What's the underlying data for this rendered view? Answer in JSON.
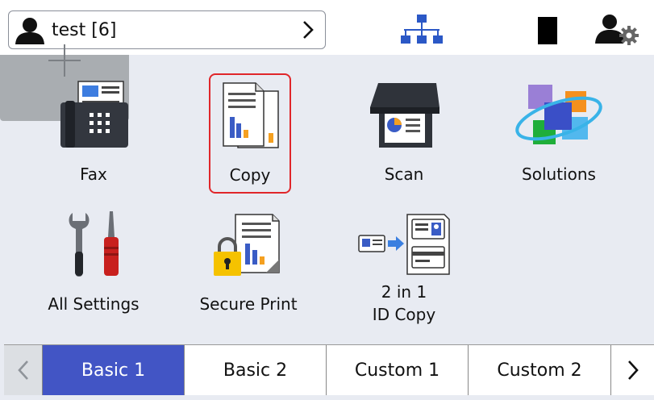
{
  "header": {
    "user_label": "test [6]"
  },
  "tiles": {
    "fax": "Fax",
    "copy": "Copy",
    "scan": "Scan",
    "solutions": "Solutions",
    "all_settings": "All Settings",
    "secure_print": "Secure Print",
    "id_copy_line1": "2 in 1",
    "id_copy_line2": "ID Copy"
  },
  "tabs": [
    {
      "label": "Basic 1",
      "active": true
    },
    {
      "label": "Basic 2",
      "active": false
    },
    {
      "label": "Custom 1",
      "active": false
    },
    {
      "label": "Custom 2",
      "active": false
    }
  ],
  "colors": {
    "accent": "#4255c5",
    "selection": "#e0262a",
    "network": "#2b58c6"
  }
}
